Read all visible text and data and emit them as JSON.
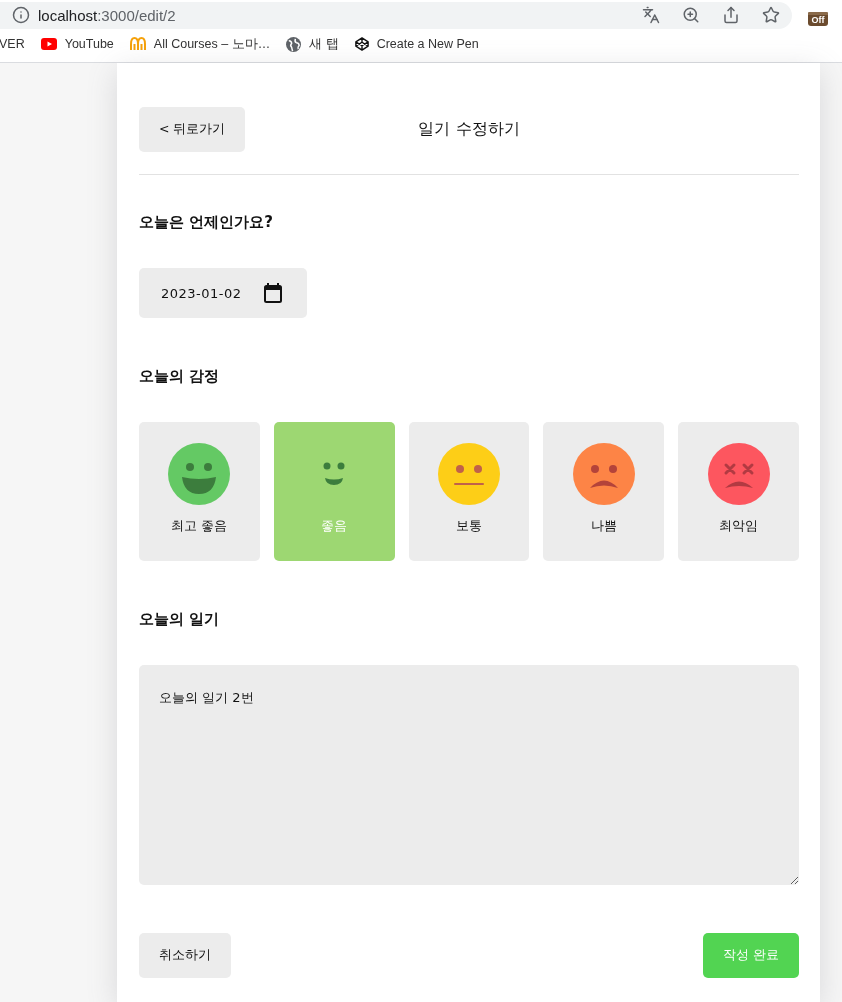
{
  "browser": {
    "address": {
      "host": "localhost",
      "path": ":3000/edit/2"
    },
    "extension_badge": "Off",
    "bookmarks": [
      {
        "kind": "plain",
        "label": "VER"
      },
      {
        "kind": "youtube",
        "label": "YouTube"
      },
      {
        "kind": "courses",
        "label": "All Courses – 노마…"
      },
      {
        "kind": "globe",
        "label": "새 탭"
      },
      {
        "kind": "codepen",
        "label": "Create a New Pen"
      }
    ]
  },
  "header": {
    "back_button": "< 뒤로가기",
    "title": "일기 수정하기"
  },
  "date_section": {
    "heading": "오늘은 언제인가요?",
    "date_value": "2023-01-02"
  },
  "emotion_section": {
    "heading": "오늘의 감정",
    "emotions": [
      {
        "kind": "great",
        "label": "최고 좋음",
        "color": "#64c964",
        "selected": false
      },
      {
        "kind": "good",
        "label": "좋음",
        "color": "#9dd772",
        "selected": true
      },
      {
        "kind": "okay",
        "label": "보통",
        "color": "#fdce17",
        "selected": false
      },
      {
        "kind": "bad",
        "label": "나쁨",
        "color": "#fd8446",
        "selected": false
      },
      {
        "kind": "terrible",
        "label": "최악임",
        "color": "#fd565f",
        "selected": false
      }
    ]
  },
  "diary_section": {
    "heading": "오늘의 일기",
    "text": "오늘의 일기 2번"
  },
  "buttons": {
    "cancel": "취소하기",
    "submit": "작성 완료"
  }
}
